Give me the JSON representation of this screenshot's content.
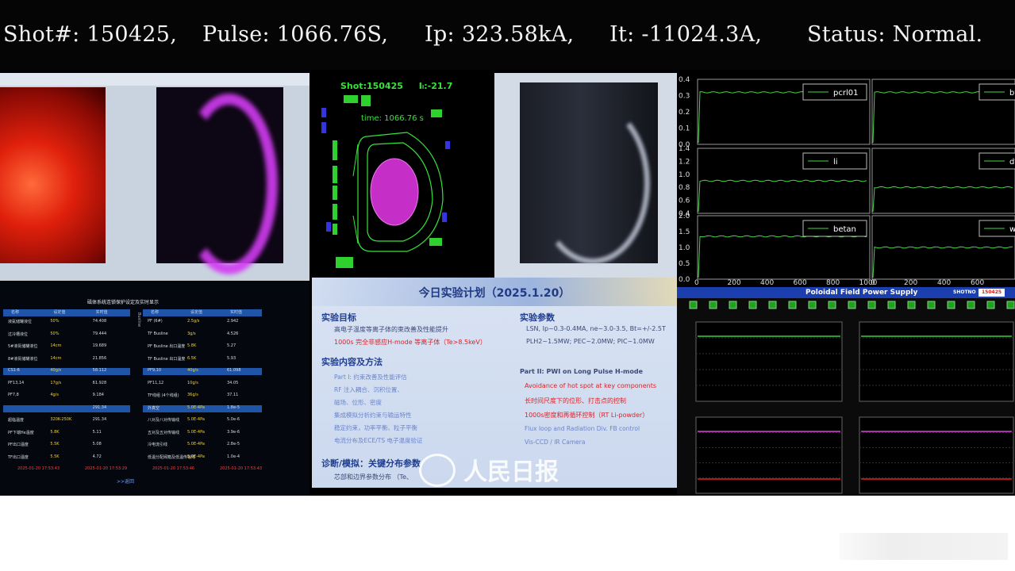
{
  "ticker": {
    "shot": "Shot#: 150425,",
    "pulse": "Pulse: 1066.76S,",
    "ip": "Ip: 323.58kA,",
    "it": "It: -11024.3A,",
    "status": "Status: Normal."
  },
  "camera_panel": {
    "colors": {
      "infrared": "#e0200c",
      "plasma": "#d23cf2"
    }
  },
  "table_panel": {
    "title": "磁体系统连锁保护设定及实时显示",
    "header": [
      "名称",
      "设定值",
      "实时值"
    ],
    "left_rows": [
      [
        "液氦储罐液位",
        "50%",
        "74.408"
      ],
      [
        "过冷槽液位",
        "50%",
        "79.444"
      ],
      [
        "5#液氮储罐液位",
        "14cm",
        "19.689"
      ],
      [
        "8#液氮储罐液位",
        "14cm",
        "21.856"
      ],
      [
        "CS1-6",
        "40g/s",
        "58.112"
      ],
      [
        "PF13,14",
        "17g/s",
        "61.928"
      ],
      [
        "PF7,8",
        "4g/s",
        "9.184"
      ],
      [
        "",
        "",
        "291.34"
      ],
      [
        "超临温度",
        "320K-250K",
        "291.34"
      ],
      [
        "PF下端He温度",
        "5.8K",
        "5.11"
      ],
      [
        "PF出口温度",
        "5.5K",
        "5.08"
      ],
      [
        "TF出口温度",
        "5.5K",
        "4.72"
      ]
    ],
    "right_rows": [
      [
        "PF (6#)",
        "2.5g/s",
        "2.942"
      ],
      [
        "TF Busline",
        "3g/s",
        "4.526"
      ],
      [
        "PF Busline 出口温度",
        "5.8K",
        "5.27"
      ],
      [
        "TF Busline 出口温度",
        "6.5K",
        "5.93"
      ],
      [
        "PF9,10",
        "40g/s",
        "61.098"
      ],
      [
        "PF11,12",
        "10g/s",
        "34.05"
      ],
      [
        "TF线组 (4个线组)",
        "36g/s",
        "37.11"
      ],
      [
        "外真空",
        "5.0E-4Pa",
        "1.8e-5"
      ],
      [
        "八对及八对传输线",
        "5.0E-4Pa",
        "5.0e-6"
      ],
      [
        "五对及五对传输线",
        "5.0E-4Pa",
        "3.9e-6"
      ],
      [
        "冷电流引线",
        "5.0E-4Pa",
        "2.8e-5"
      ],
      [
        "低温分配阀箱及低温传输线",
        "5.0E-4Pa",
        "1.0e-4"
      ]
    ],
    "side_label": "Busline",
    "footer": [
      "2025-01-20 17:53:43",
      "2025-01-20 17:53:29",
      "2025-01-20 17:53:46",
      "2025-01-20 17:53:43"
    ],
    "back_link": ">>返回"
  },
  "tokamak_panel": {
    "shot": "Shot:150425",
    "ip": "Iₗ:-21.7",
    "time": "time:  1066.76 s",
    "colors": {
      "coil": "#2fd12f",
      "coil_alt": "#3434e0",
      "plasma": "#c52fc8",
      "boundary": "#37e33a"
    }
  },
  "ir_panel": {
    "colors": {
      "bg": "#d3dbe6"
    }
  },
  "plan_slide": {
    "title": "今日实验计划（2025.1.20）",
    "section1": {
      "heading": "实验目标",
      "items": [
        "高电子温度等离子体的束改善及性能提升",
        "1000s 完全非感应H-mode 等离子体（Te>8.5keV）"
      ]
    },
    "section2": {
      "heading": "实验参数",
      "items": [
        "LSN, Ip~0.3-0.4MA, ne~3.0-3.5, Bt=+/-2.5T",
        "PLH2~1.5MW; PEC~2.0MW; PIC~1.0MW"
      ]
    },
    "section3": {
      "heading": "实验内容及方法",
      "items": [
        "Part I: 约束改善及性能评估",
        "RF 注入耦合、沉积位置、",
        "磁场、位形、密度",
        "集成模拟分析约束与输运特性",
        "稳定约束，功率平衡、粒子平衡",
        "电流分布及ECE/TS 电子温度验证"
      ]
    },
    "section4": {
      "heading": "Part II: PWI on Long Pulse H-mode",
      "items": [
        "Avoidance of hot spot at key components",
        "长时间尺度下的位形、打击点的控制",
        "1000s密度和再循环控制（RT Li-powder）",
        "Flux loop and Radiation Div. FB control",
        "Vis-CCD / IR Camera"
      ]
    },
    "section5": {
      "heading": "诊断/模拟：关键分布参数",
      "items": [
        "芯部和边界参数分布 （Te、"
      ]
    }
  },
  "plot_panel": {
    "subplots": [
      {
        "legend": "pcrl01",
        "yticks": [
          "0.4",
          "0.3",
          "0.2",
          "0.1",
          "0.0"
        ]
      },
      {
        "legend": "bt",
        "yticks": []
      },
      {
        "legend": "li",
        "yticks": [
          "1.4",
          "1.2",
          "1.0",
          "0.8",
          "0.6",
          "0.4"
        ]
      },
      {
        "legend": "dfsdev",
        "yticks": []
      },
      {
        "legend": "betan",
        "yticks": [
          "2.0",
          "1.5",
          "1.0",
          "0.5",
          "0.0"
        ]
      },
      {
        "legend": "wmhd",
        "yticks": []
      }
    ],
    "xticks": [
      "0",
      "200",
      "400",
      "600",
      "800",
      "1000"
    ],
    "trace_color": "#46d646"
  },
  "chart_data": [
    {
      "type": "line",
      "title": "",
      "xlabel": "",
      "ylabel": "",
      "series": [
        {
          "name": "pcrl01",
          "x": [
            0,
            200,
            400,
            600,
            800,
            1000
          ],
          "y": [
            0.32,
            0.32,
            0.32,
            0.32,
            0.32,
            0.32
          ]
        }
      ],
      "xlim": [
        0,
        1000
      ],
      "ylim": [
        0,
        0.4
      ]
    },
    {
      "type": "line",
      "title": "",
      "xlabel": "",
      "ylabel": "",
      "series": [
        {
          "name": "li",
          "x": [
            0,
            200,
            400,
            600,
            800,
            1000
          ],
          "y": [
            0.9,
            0.9,
            0.9,
            0.9,
            0.9,
            0.91
          ]
        }
      ],
      "xlim": [
        0,
        1000
      ],
      "ylim": [
        0.4,
        1.4
      ]
    },
    {
      "type": "line",
      "title": "",
      "xlabel": "",
      "ylabel": "",
      "series": [
        {
          "name": "betan",
          "x": [
            0,
            200,
            400,
            600,
            800,
            1000
          ],
          "y": [
            1.35,
            1.35,
            1.36,
            1.35,
            1.35,
            1.35
          ]
        }
      ],
      "xlim": [
        0,
        1000
      ],
      "ylim": [
        0,
        2.0
      ]
    }
  ],
  "pf_panel": {
    "title": "Poloidal Field Power Supply",
    "shot_label": "SHOTNO",
    "shot_value": "150425",
    "colors": {
      "title_bg": "#1b3fae",
      "line_green": "#37d037",
      "line_red": "#e02020",
      "line_magenta": "#e040e0"
    }
  },
  "watermark": {
    "text": "人民日报"
  }
}
